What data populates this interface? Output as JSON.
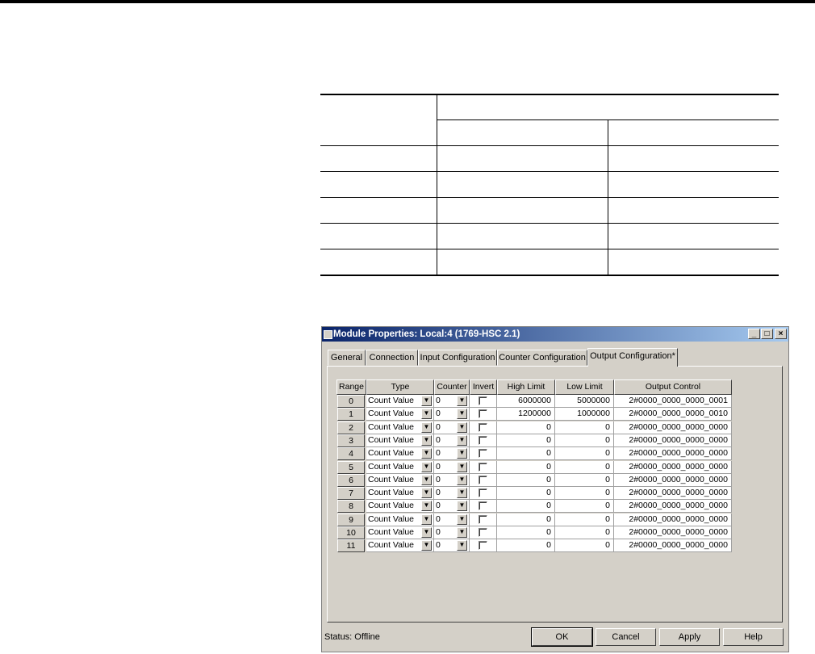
{
  "window": {
    "title": "Module Properties: Local:4 (1769-HSC 2.1)",
    "controls": {
      "minimize": "_",
      "maximize": "□",
      "close": "×"
    }
  },
  "tabs": [
    "General",
    "Connection",
    "Input Configuration",
    "Counter Configuration",
    "Output Configuration*"
  ],
  "active_tab": "Output Configuration*",
  "grid": {
    "columns": [
      "Range",
      "Type",
      "Counter",
      "Invert",
      "High Limit",
      "Low Limit",
      "Output Control"
    ],
    "rows": [
      {
        "range": "0",
        "type": "Count Value",
        "counter": "0",
        "high": "6000000",
        "low": "5000000",
        "output": "2#0000_0000_0000_0001"
      },
      {
        "range": "1",
        "type": "Count Value",
        "counter": "0",
        "high": "1200000",
        "low": "1000000",
        "output": "2#0000_0000_0000_0010"
      },
      {
        "range": "2",
        "type": "Count Value",
        "counter": "0",
        "high": "0",
        "low": "0",
        "output": "2#0000_0000_0000_0000"
      },
      {
        "range": "3",
        "type": "Count Value",
        "counter": "0",
        "high": "0",
        "low": "0",
        "output": "2#0000_0000_0000_0000"
      },
      {
        "range": "4",
        "type": "Count Value",
        "counter": "0",
        "high": "0",
        "low": "0",
        "output": "2#0000_0000_0000_0000"
      },
      {
        "range": "5",
        "type": "Count Value",
        "counter": "0",
        "high": "0",
        "low": "0",
        "output": "2#0000_0000_0000_0000"
      },
      {
        "range": "6",
        "type": "Count Value",
        "counter": "0",
        "high": "0",
        "low": "0",
        "output": "2#0000_0000_0000_0000"
      },
      {
        "range": "7",
        "type": "Count Value",
        "counter": "0",
        "high": "0",
        "low": "0",
        "output": "2#0000_0000_0000_0000"
      },
      {
        "range": "8",
        "type": "Count Value",
        "counter": "0",
        "high": "0",
        "low": "0",
        "output": "2#0000_0000_0000_0000"
      },
      {
        "range": "9",
        "type": "Count Value",
        "counter": "0",
        "high": "0",
        "low": "0",
        "output": "2#0000_0000_0000_0000"
      },
      {
        "range": "10",
        "type": "Count Value",
        "counter": "0",
        "high": "0",
        "low": "0",
        "output": "2#0000_0000_0000_0000"
      },
      {
        "range": "11",
        "type": "Count Value",
        "counter": "0",
        "high": "0",
        "low": "0",
        "output": "2#0000_0000_0000_0000"
      }
    ]
  },
  "status": "Status:  Offline",
  "buttons": {
    "ok": "OK",
    "cancel": "Cancel",
    "apply": "Apply",
    "help": "Help"
  },
  "icons": {
    "dropdown": "▼"
  },
  "colors": {
    "title_start": "#0a246a",
    "title_end": "#a6caf0",
    "face": "#d4d0c8"
  }
}
